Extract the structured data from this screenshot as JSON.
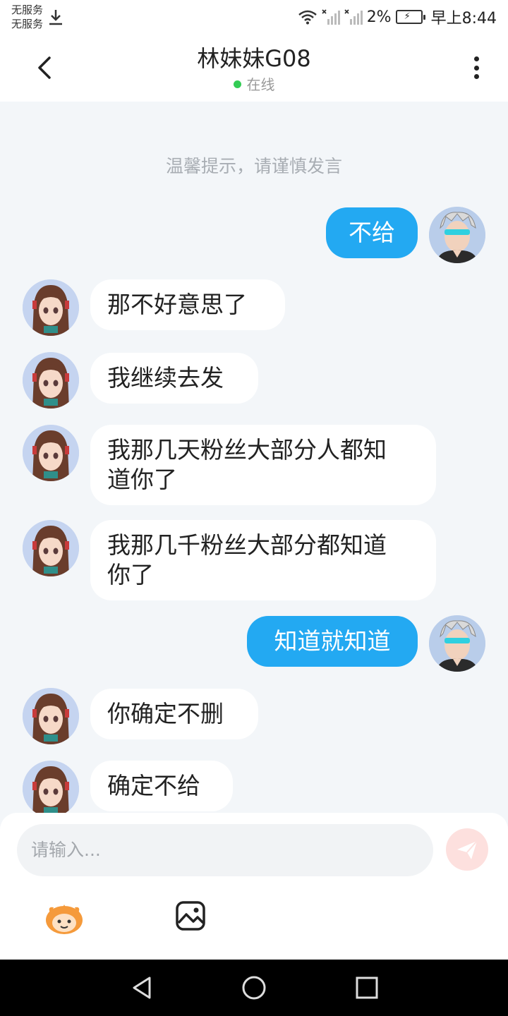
{
  "status_bar": {
    "carrier_line1": "无服务",
    "carrier_line2": "无服务",
    "battery_percent": "2%",
    "time": "早上8:44"
  },
  "header": {
    "title": "林妹妹G08",
    "status": "在线"
  },
  "chat": {
    "tip": "温馨提示，请谨慎发言",
    "messages": [
      {
        "side": "out",
        "text": "不给"
      },
      {
        "side": "in",
        "text": "那不好意思了"
      },
      {
        "side": "in",
        "text": "我继续去发"
      },
      {
        "side": "in",
        "line1": "我那几天粉丝大部分人都知",
        "line2": "道你了"
      },
      {
        "side": "in",
        "line1": "我那几千粉丝大部分都知道",
        "line2": "你了"
      },
      {
        "side": "out",
        "text": "知道就知道"
      },
      {
        "side": "in",
        "text": "你确定不删"
      },
      {
        "side": "in",
        "text": "确定不给"
      }
    ]
  },
  "input": {
    "placeholder": "请输入..."
  },
  "colors": {
    "accent": "#23a9f2",
    "online": "#33cc55",
    "send_button": "#fde0de"
  },
  "icons": [
    "download-icon",
    "wifi-icon",
    "signal-icon",
    "battery-icon",
    "back-icon",
    "more-icon",
    "send-icon",
    "emoji-icon",
    "image-icon",
    "nav-back-icon",
    "nav-home-icon",
    "nav-recents-icon"
  ]
}
